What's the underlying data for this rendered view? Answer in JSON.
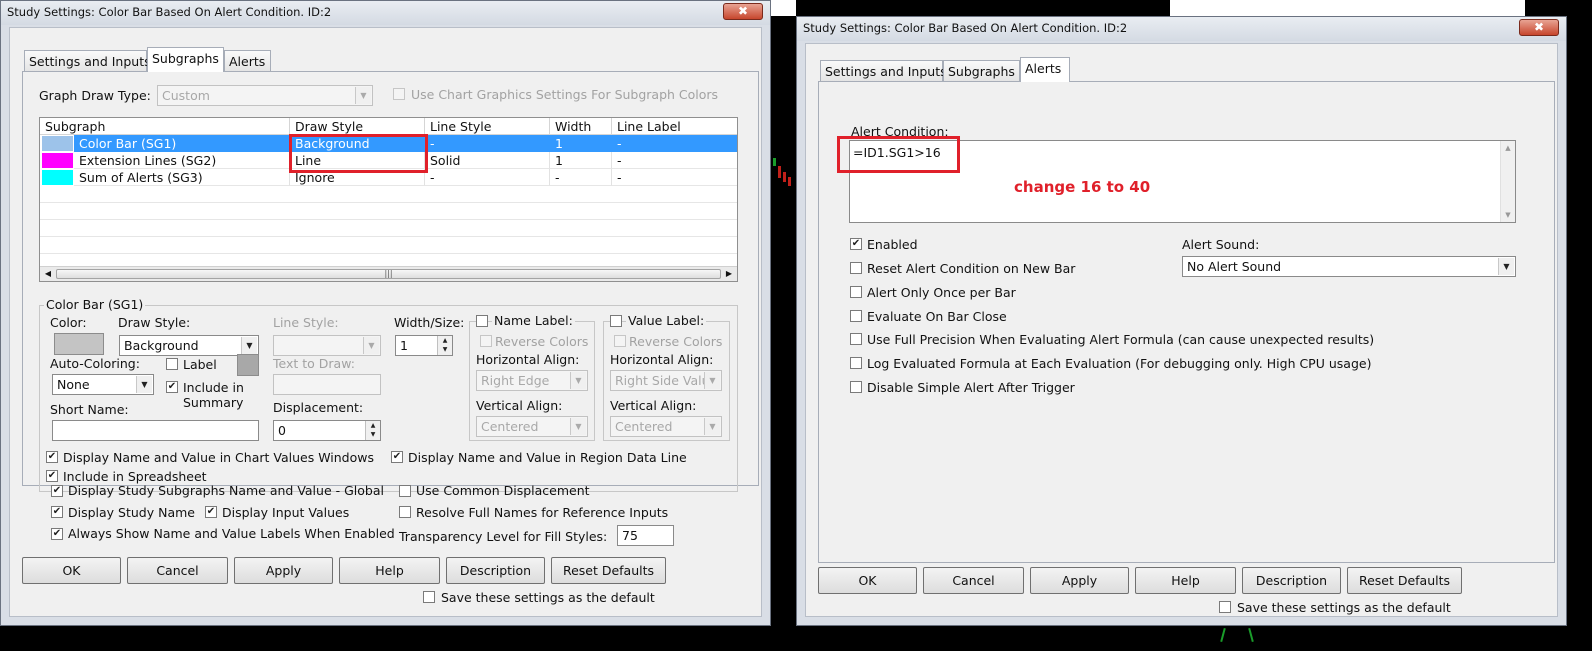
{
  "colors": {
    "desktop": "#000000",
    "selection": "#3399ff",
    "highlight_box": "#e0202a",
    "annotation": "#e0202a",
    "sg1_swatch": "#9dc3ea",
    "sg2_swatch": "#ff00ff",
    "sg3_swatch": "#00ffff"
  },
  "left_window": {
    "title": "Study Settings: Color Bar Based On Alert Condition. ID:2",
    "close_icon": "✖",
    "tabs": [
      "Settings and Inputs",
      "Subgraphs",
      "Alerts"
    ],
    "graph_draw_type": {
      "label": "Graph Draw Type:",
      "value": "Custom"
    },
    "use_chart_graphics": "Use Chart Graphics Settings For Subgraph Colors",
    "grid": {
      "columns": [
        "Subgraph",
        "Draw Style",
        "Line Style",
        "Width",
        "Line Label"
      ],
      "rows": [
        {
          "name": "Color Bar (SG1)",
          "draw_style": "Background",
          "line_style": "-",
          "width": "1",
          "label": "-"
        },
        {
          "name": "Extension Lines (SG2)",
          "draw_style": "Line",
          "line_style": "Solid",
          "width": "1",
          "label": "-"
        },
        {
          "name": "Sum of Alerts (SG3)",
          "draw_style": "Ignore",
          "line_style": "-",
          "width": "-",
          "label": "-"
        }
      ],
      "scroll_grip": "|||"
    },
    "subgraph_group": {
      "title": "Color Bar (SG1)",
      "color_label": "Color:",
      "draw_style_label": "Draw Style:",
      "draw_style_value": "Background",
      "line_style_label": "Line Style:",
      "width_label": "Width/Size:",
      "width_value": "1",
      "auto_coloring_label": "Auto-Coloring:",
      "auto_coloring_value": "None",
      "label_check": "Label",
      "include_in_summary": "Include in Summary",
      "text_to_draw_label": "Text to Draw:",
      "short_name_label": "Short Name:",
      "short_name_value": "",
      "displacement_label": "Displacement:",
      "displacement_value": "0",
      "name_label_group": {
        "title": "Name Label:",
        "reverse": "Reverse Colors",
        "halign_label": "Horizontal Align:",
        "halign_value": "Right Edge",
        "valign_label": "Vertical Align:",
        "valign_value": "Centered"
      },
      "value_label_group": {
        "title": "Value Label:",
        "reverse": "Reverse Colors",
        "halign_label": "Horizontal Align:",
        "halign_value": "Right Side Valu",
        "valign_label": "Vertical Align:",
        "valign_value": "Centered"
      },
      "display_chart_values": "Display Name and Value in Chart Values Windows",
      "display_region": "Display Name and Value in Region Data Line",
      "include_spreadsheet": "Include in Spreadsheet"
    },
    "global_options": {
      "display_global": "Display Study Subgraphs Name and Value - Global",
      "use_common_displacement": "Use Common Displacement",
      "display_study_name": "Display Study Name",
      "display_input_values": "Display Input Values",
      "resolve_full_names": "Resolve Full Names for Reference Inputs",
      "always_show": "Always Show Name and Value Labels When Enabled",
      "transparency_label": "Transparency Level for Fill Styles:",
      "transparency_value": "75"
    },
    "buttons": [
      "OK",
      "Cancel",
      "Apply",
      "Help",
      "Description",
      "Reset Defaults"
    ],
    "save_default": "Save these settings as the default"
  },
  "right_window": {
    "title": "Study Settings: Color Bar Based On Alert Condition. ID:2",
    "close_icon": "✖",
    "tabs": [
      "Settings and Inputs",
      "Subgraphs",
      "Alerts"
    ],
    "alert_condition_label": "Alert Condition:",
    "alert_condition_value": "=ID1.SG1>16",
    "annotation": "change 16 to 40",
    "options": [
      {
        "label": "Enabled",
        "checked": true
      },
      {
        "label": "Reset Alert Condition on New Bar",
        "checked": false
      },
      {
        "label": "Alert Only Once per Bar",
        "checked": false
      },
      {
        "label": "Evaluate On Bar Close",
        "checked": false
      },
      {
        "label": "Use Full Precision When Evaluating Alert Formula (can cause unexpected results)",
        "checked": false
      },
      {
        "label": "Log Evaluated Formula at Each Evaluation (For debugging only. High CPU usage)",
        "checked": false
      },
      {
        "label": "Disable Simple Alert After Trigger",
        "checked": false
      }
    ],
    "alert_sound_label": "Alert Sound:",
    "alert_sound_value": "No Alert Sound",
    "buttons": [
      "OK",
      "Cancel",
      "Apply",
      "Help",
      "Description",
      "Reset Defaults"
    ],
    "save_default": "Save these settings as the default"
  }
}
